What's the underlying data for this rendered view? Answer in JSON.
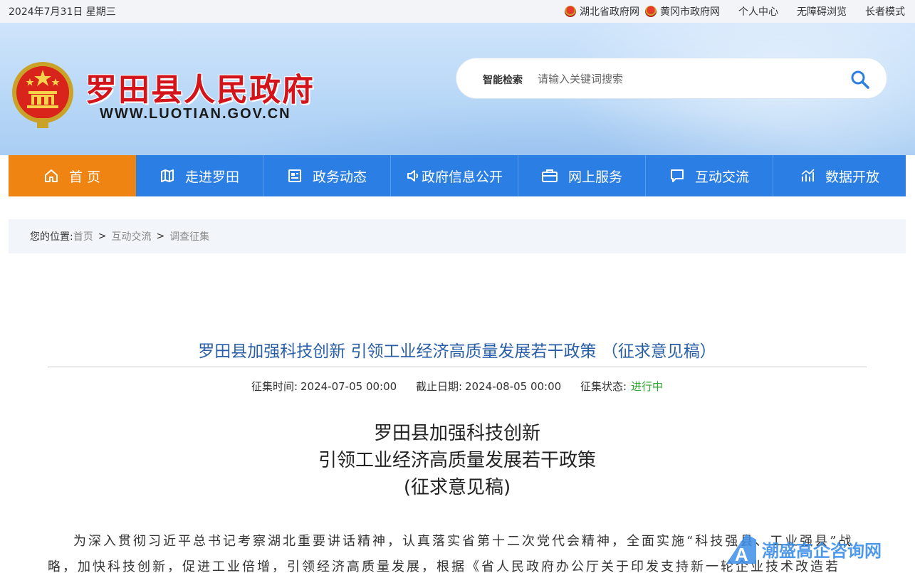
{
  "topbar": {
    "date": "2024年7月31日 星期三",
    "links": [
      "湖北省政府网",
      "黄冈市政府网",
      "个人中心",
      "无障碍浏览",
      "长者模式"
    ]
  },
  "header": {
    "site_name": "罗田县人民政府",
    "site_url": "WWW.LUOTIAN.GOV.CN",
    "search_label": "智能检索",
    "search_placeholder": "请输入关键词搜索"
  },
  "nav": {
    "items": [
      {
        "label": "首 页",
        "icon": "home-icon"
      },
      {
        "label": "走进罗田",
        "icon": "map-icon"
      },
      {
        "label": "政务动态",
        "icon": "news-icon"
      },
      {
        "label": "政府信息公开",
        "icon": "speaker-icon"
      },
      {
        "label": "网上服务",
        "icon": "briefcase-icon"
      },
      {
        "label": "互动交流",
        "icon": "chat-icon"
      },
      {
        "label": "数据开放",
        "icon": "chart-icon"
      }
    ],
    "active_color": "#f08412",
    "bar_color": "#2b7ee3"
  },
  "breadcrumb": {
    "prefix": "您的位置:",
    "items": [
      "首页",
      "互动交流",
      "调查征集"
    ],
    "sep": ">"
  },
  "article": {
    "title": "罗田县加强科技创新 引领工业经济高质量发展若干政策 （征求意见稿）",
    "meta": {
      "collect_label": "征集时间:",
      "collect_value": "2024-07-05 00:00",
      "deadline_label": "截止日期:",
      "deadline_value": "2024-08-05 00:00",
      "status_label": "征集状态:",
      "status_value": "进行中"
    },
    "doc_title_lines": [
      "罗田县加强科技创新",
      "引领工业经济高质量发展若干政策",
      "(征求意见稿)"
    ],
    "body": "为深入贯彻习近平总书记考察湖北重要讲话精神，认真落实省第十二次党代会精神，全面实施“科技强县、工业强县”战略，加快科技创新，促进工业倍增，引领经济高质量发展，根据《省人民政府办公厅关于印发支持新一轮企业技术改造若"
  },
  "watermark": {
    "text": "潮盛高企咨询网"
  }
}
